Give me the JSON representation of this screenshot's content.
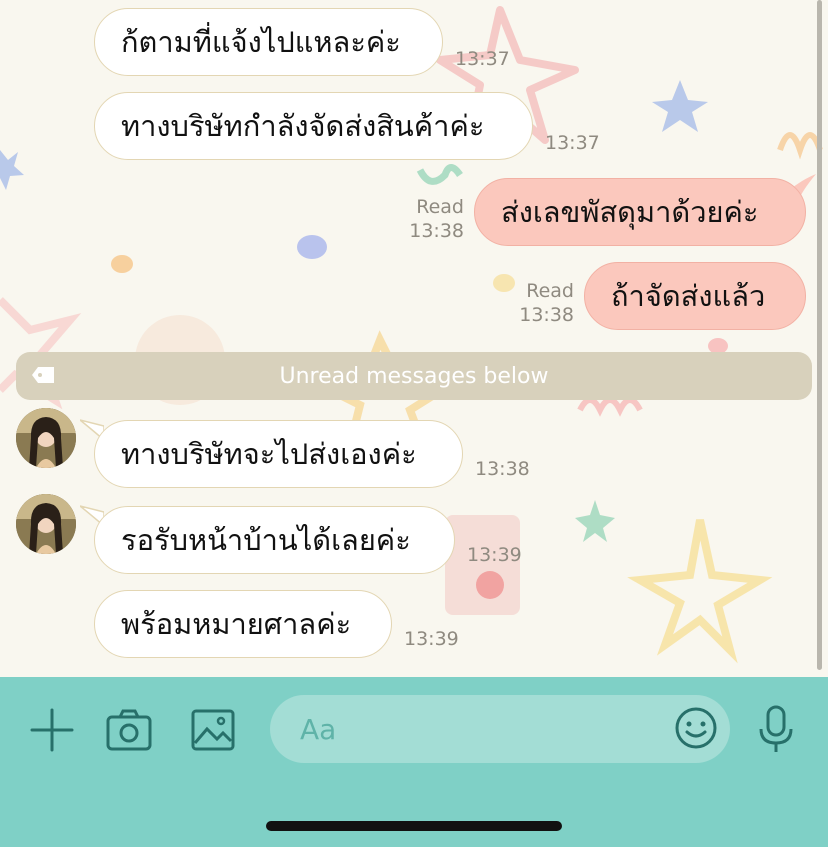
{
  "chat": {
    "messages": [
      {
        "text": "ก้ตามที่แจ้งไปแหละค่ะ",
        "time": "13:37"
      },
      {
        "text": "ทางบริษัทกำลังจัดส่งสินค้าค่ะ",
        "time": "13:37"
      },
      {
        "text": "ส่งเลขพัสดุมาด้วยค่ะ",
        "status": "Read",
        "time": "13:38"
      },
      {
        "text": "ถ้าจัดส่งแล้ว",
        "status": "Read",
        "time": "13:38"
      },
      {
        "text": "ทางบริษัทจะไปส่งเองค่ะ",
        "time": "13:38"
      },
      {
        "text": "รอรับหน้าบ้านได้เลยค่ะ",
        "time": "13:39"
      },
      {
        "text": "พร้อมหมายศาลค่ะ",
        "time": "13:39"
      }
    ],
    "unread_divider": "Unread messages below"
  },
  "composer": {
    "placeholder": "Aa",
    "icons": [
      "plus-icon",
      "camera-icon",
      "image-icon",
      "emoji-icon",
      "microphone-icon"
    ]
  },
  "colors": {
    "outgoing_bubble": "#fbc8bd",
    "incoming_bubble": "#ffffff",
    "input_bar": "#7fd0c6",
    "input_field": "#a3ddd5"
  }
}
